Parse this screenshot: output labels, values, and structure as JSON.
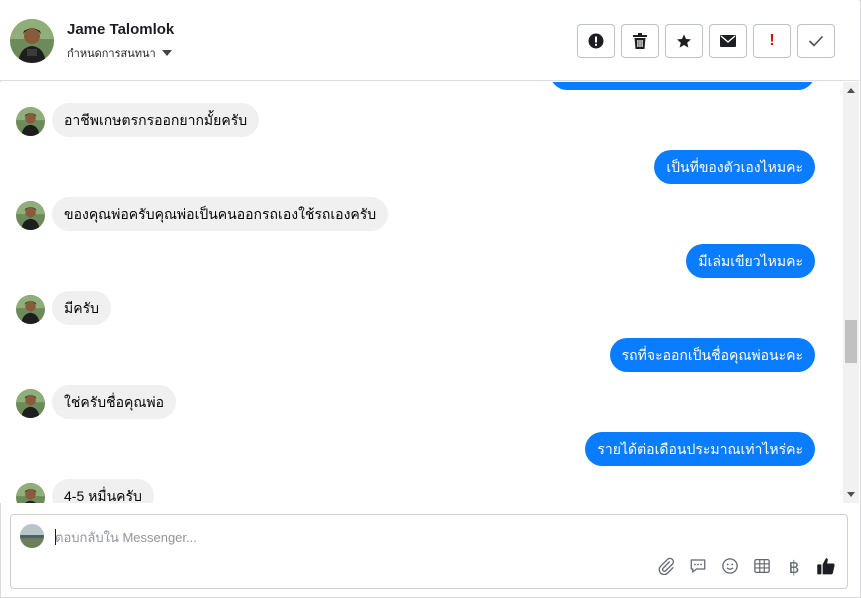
{
  "header": {
    "name": "Jame Talomlok",
    "subtitle": "กำหนดการสนทนา"
  },
  "messages": [
    {
      "dir": "in",
      "text": "อาชีพเกษตรกรออกยากมั้ยครับ"
    },
    {
      "dir": "out",
      "text": "เป็นที่ของตัวเองไหมคะ"
    },
    {
      "dir": "in",
      "text": "ของคุณพ่อครับคุณพ่อเป็นคนออกรถเองใช้รถเองครับ"
    },
    {
      "dir": "out",
      "text": "มีเล่มเขียวไหมคะ"
    },
    {
      "dir": "in",
      "text": "มีครับ"
    },
    {
      "dir": "out",
      "text": "รถที่จะออกเป็นชื่อคุณพ่อนะคะ"
    },
    {
      "dir": "in",
      "text": "ใช่ครับชื่อคุณพ่อ"
    },
    {
      "dir": "out",
      "text": "รายได้ต่อเดือนประมาณเท่าไหร่คะ"
    },
    {
      "dir": "in",
      "text": "4-5 หมื่นครับ"
    }
  ],
  "composer": {
    "placeholder": "ตอบกลับใน Messenger..."
  },
  "colors": {
    "outgoing_bubble": "#0a7cff",
    "incoming_bubble": "#f0f0f0",
    "mark_spam": "#d4130b"
  },
  "icons": {
    "actions": [
      "info-icon",
      "trash-icon",
      "star-icon",
      "envelope-icon",
      "exclamation-icon",
      "check-icon"
    ],
    "composer_tools": [
      "paperclip-icon",
      "speech-bubble-icon",
      "smiley-icon",
      "table-icon",
      "baht-icon",
      "thumbs-up-icon"
    ]
  }
}
